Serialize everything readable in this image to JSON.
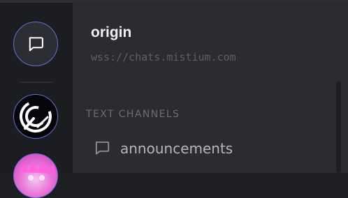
{
  "server": {
    "name": "origin",
    "url": "wss://chats.mistium.com"
  },
  "sidebar": {
    "section_header": "TEXT CHANNELS",
    "channels": [
      {
        "label": "announcements",
        "icon": "chat-bubble-icon"
      }
    ]
  },
  "rail": {
    "buttons": [
      {
        "icon": "chat-bubble-icon"
      },
      {
        "icon": "server-avatar"
      },
      {
        "icon": "server-avatar"
      }
    ]
  },
  "colors": {
    "accent": "#6c6cd6",
    "panel_bg": "#2b2c31",
    "rail_bg": "#1c1d21"
  }
}
